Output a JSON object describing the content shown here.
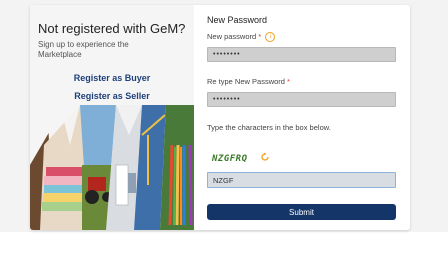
{
  "promo": {
    "title": "Not registered with GeM?",
    "subtitle": "Sign up to experience the Marketplace",
    "register_buyer": "Register as Buyer",
    "register_seller": "Register as Seller"
  },
  "form": {
    "heading": "New Password",
    "new_password_label": "New password",
    "new_password_value": "••••••••",
    "retype_label": "Re type New Password",
    "retype_value": "••••••••",
    "required_mark": "*",
    "info_glyph": "i",
    "captcha_label": "Type the characters in the box below.",
    "captcha_text": "NZGFRQ",
    "captcha_input_value": "NZGF",
    "submit_label": "Submit"
  },
  "colors": {
    "accent": "#143568",
    "link": "#1f3f7a",
    "required": "#e0332c",
    "captcha": "#3a7a28",
    "icon": "#f0a020"
  },
  "icons": {
    "info": "info-icon",
    "refresh": "refresh-icon"
  }
}
